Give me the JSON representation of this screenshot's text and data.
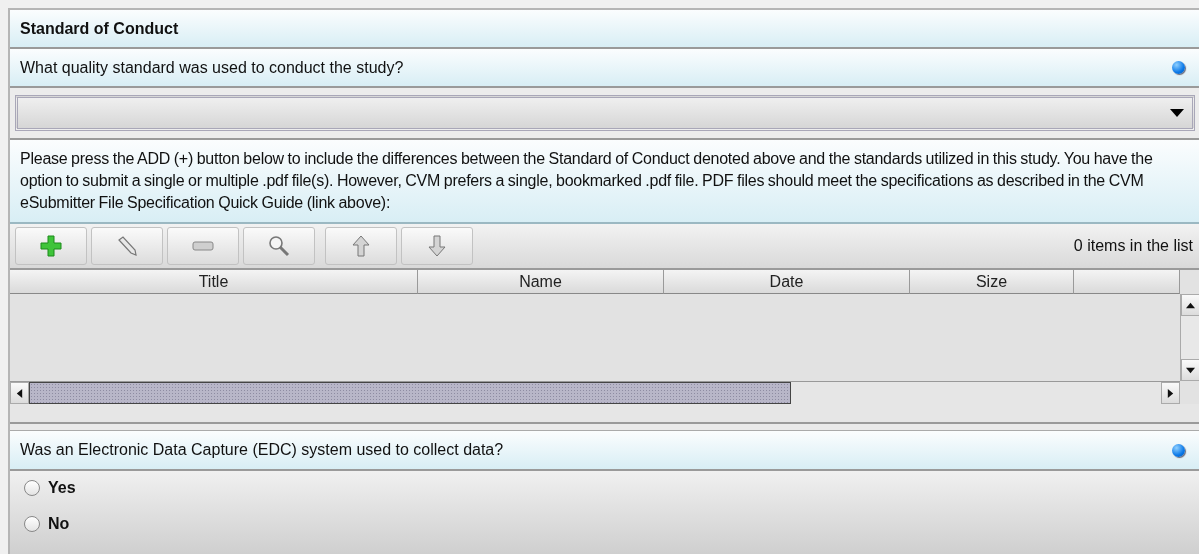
{
  "section": {
    "title": "Standard of Conduct"
  },
  "question_1": {
    "text": "What quality standard was used to conduct the study?"
  },
  "instructions": "Please press the ADD (+) button below to include the differences between the Standard of Conduct denoted above and the standards utilized in this study. You have the option to submit a single or multiple .pdf file(s). However, CVM prefers a single, bookmarked .pdf file. PDF files should meet the specifications as described in the CVM eSubmitter File Specification Quick Guide (link above):",
  "item_count": "0 items in the list",
  "table": {
    "columns": [
      "Title",
      "Name",
      "Date",
      "Size"
    ]
  },
  "question_2": {
    "text": "Was an Electronic Data Capture (EDC) system used to collect data?"
  },
  "options": [
    {
      "label": "Yes",
      "selected": false
    },
    {
      "label": "No",
      "selected": false
    }
  ]
}
